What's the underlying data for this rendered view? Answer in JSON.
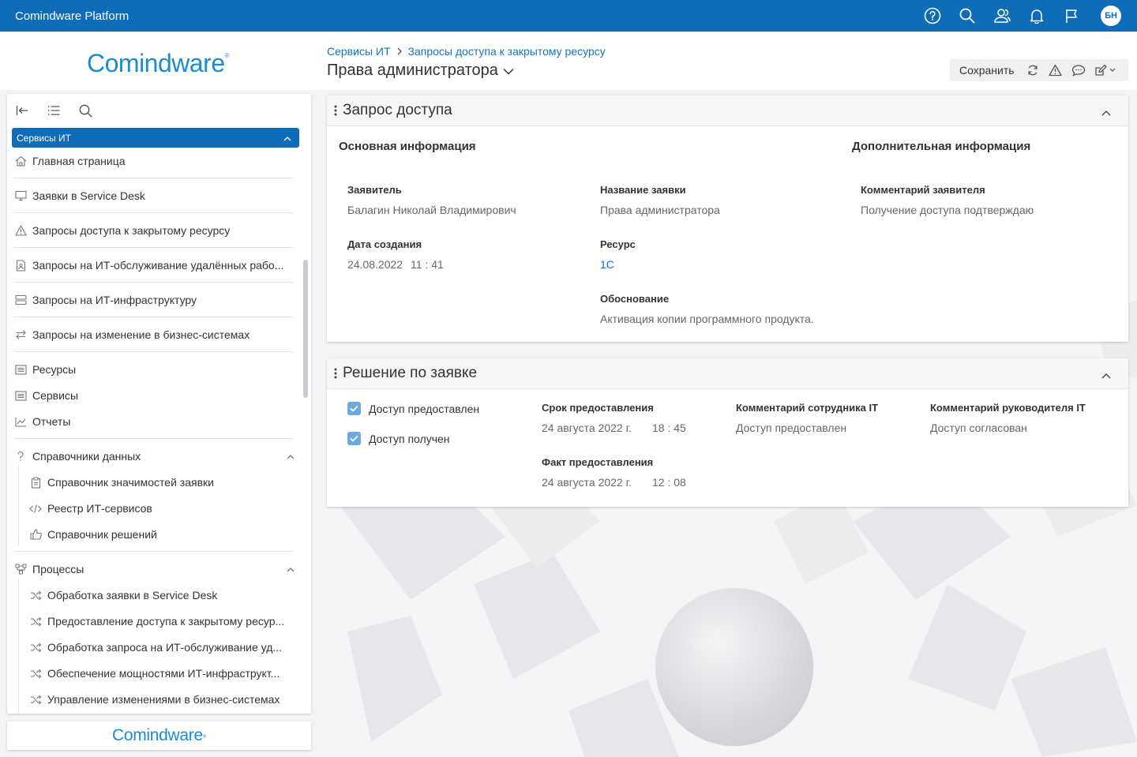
{
  "app": {
    "title": "Comindware Platform",
    "user_initials": "БН"
  },
  "logo": {
    "text": "Comindware",
    "mark": "®"
  },
  "breadcrumb": {
    "root": "Сервисы ИТ",
    "current": "Запросы доступа к закрытому ресурсу"
  },
  "page": {
    "title": "Права администратора"
  },
  "toolbar": {
    "save_label": "Сохранить"
  },
  "sidebar": {
    "header": "Сервисы ИТ",
    "items": [
      {
        "label": "Главная страница",
        "icon": "home-icon"
      },
      {
        "label": "Заявки в Service Desk",
        "icon": "monitor-icon"
      },
      {
        "label": "Запросы доступа к закрытому ресурсу",
        "icon": "warning-icon"
      },
      {
        "label": "Запросы на ИТ-обслуживание удалённых рабо...",
        "icon": "document-icon"
      },
      {
        "label": "Запросы на ИТ-инфраструктуру",
        "icon": "server-icon"
      },
      {
        "label": "Запросы на изменение в бизнес-системах",
        "icon": "swap-icon"
      },
      {
        "label": "Ресурсы",
        "icon": "list-icon"
      },
      {
        "label": "Сервисы",
        "icon": "list-icon"
      },
      {
        "label": "Отчеты",
        "icon": "chart-icon"
      }
    ],
    "groups": [
      {
        "label": "Справочники данных",
        "icon": "question-icon",
        "items": [
          {
            "label": "Справочник значимостей заявки",
            "icon": "clipboard-icon"
          },
          {
            "label": "Реестр ИТ-сервисов",
            "icon": "code-icon"
          },
          {
            "label": "Справочник решений",
            "icon": "thumbs-up-icon"
          }
        ]
      },
      {
        "label": "Процессы",
        "icon": "process-icon",
        "items": [
          {
            "label": "Обработка заявки в Service Desk",
            "icon": "shuffle-icon"
          },
          {
            "label": "Предоставление доступа к закрытому ресур...",
            "icon": "shuffle-icon"
          },
          {
            "label": "Обработка запроса на ИТ-обслуживание уд...",
            "icon": "shuffle-icon"
          },
          {
            "label": "Обеспечение мощностями ИТ-инфраструкт...",
            "icon": "shuffle-icon"
          },
          {
            "label": "Управление изменениями в бизнес-системах",
            "icon": "shuffle-icon"
          }
        ]
      }
    ],
    "footer_logo": "Comindware"
  },
  "panel1": {
    "title": "Запрос доступа",
    "main_info_title": "Основная информация",
    "extra_info_title": "Дополнительная информация",
    "applicant_label": "Заявитель",
    "applicant_value": "Балагин Николай Владимирович",
    "created_label": "Дата создания",
    "created_date": "24.08.2022",
    "created_time": "11 : 41",
    "request_name_label": "Название заявки",
    "request_name_value": "Права администратора",
    "resource_label": "Ресурс",
    "resource_value": "1С",
    "reason_label": "Обоснование",
    "reason_value": "Активация копии программного продукта.",
    "comment_label": "Комментарий заявителя",
    "comment_value": "Получение доступа подтверждаю"
  },
  "panel2": {
    "title": "Решение по заявке",
    "check1_label": "Доступ предоставлен",
    "check1_checked": true,
    "check2_label": "Доступ получен",
    "check2_checked": true,
    "deadline_label": "Срок предоставления",
    "deadline_date": "24 августа 2022 г.",
    "deadline_time": "18 : 45",
    "actual_label": "Факт предоставления",
    "actual_date": "24 августа 2022 г.",
    "actual_time": "12 : 08",
    "it_comment_label": "Комментарий сотрудника IT",
    "it_comment_value": "Доступ предоставлен",
    "mgr_comment_label": "Комментарий руководителя IT",
    "mgr_comment_value": "Доступ согласован"
  },
  "colors": {
    "brand": "#0f6cb8",
    "logo": "#1a8ccf",
    "link": "#1475c0",
    "checkbox": "#6fa8dc"
  }
}
